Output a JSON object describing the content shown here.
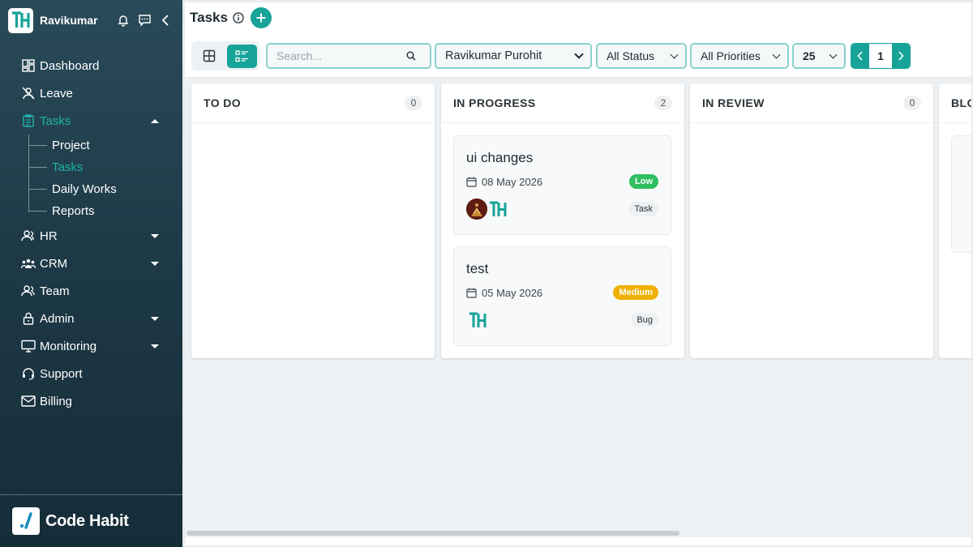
{
  "user": {
    "name": "Ravikumar"
  },
  "sidebar": {
    "items": [
      {
        "label": "Dashboard",
        "icon": "dashboard-icon"
      },
      {
        "label": "Leave",
        "icon": "leave-icon"
      },
      {
        "label": "Tasks",
        "icon": "tasks-icon",
        "active": true,
        "expanded": true,
        "children": [
          {
            "label": "Project"
          },
          {
            "label": "Tasks",
            "active": true
          },
          {
            "label": "Daily Works"
          },
          {
            "label": "Reports"
          }
        ]
      },
      {
        "label": "HR",
        "icon": "hr-icon",
        "has_children": true
      },
      {
        "label": "CRM",
        "icon": "crm-icon",
        "has_children": true
      },
      {
        "label": "Team",
        "icon": "team-icon"
      },
      {
        "label": "Admin",
        "icon": "lock-icon",
        "has_children": true
      },
      {
        "label": "Monitoring",
        "icon": "monitor-icon",
        "has_children": true
      },
      {
        "label": "Support",
        "icon": "support-icon"
      },
      {
        "label": "Billing",
        "icon": "mail-icon"
      }
    ],
    "brand": "Code Habit"
  },
  "header": {
    "title": "Tasks"
  },
  "toolbar": {
    "search_placeholder": "Search...",
    "assignee": "Ravikumar Purohit",
    "status": "All Status",
    "priority": "All Priorities",
    "page_size": "25",
    "page": "1"
  },
  "colors": {
    "accent": "#17a398",
    "low": "#2fbf5f",
    "medium": "#f0b000"
  },
  "board": {
    "columns": [
      {
        "title": "TO DO",
        "count": "0",
        "cards": []
      },
      {
        "title": "IN PROGRESS",
        "count": "2",
        "cards": [
          {
            "title": "ui changes",
            "date": "08 May 2026",
            "priority": "Low",
            "tag": "Task",
            "has_avatar": true
          },
          {
            "title": "test",
            "date": "05 May 2026",
            "priority": "Medium",
            "tag": "Bug",
            "has_avatar": false
          }
        ]
      },
      {
        "title": "IN REVIEW",
        "count": "0",
        "cards": []
      },
      {
        "title": "BLOCKED",
        "count": "",
        "cards": []
      }
    ]
  }
}
